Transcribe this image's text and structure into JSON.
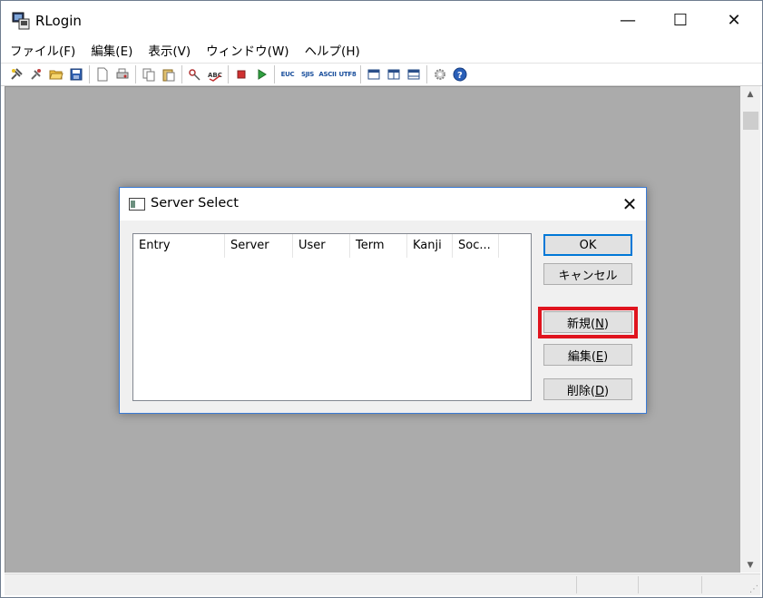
{
  "app": {
    "title": "RLogin",
    "window_controls": {
      "minimize": "—",
      "maximize": "☐",
      "close": "✕"
    }
  },
  "menubar": {
    "items": [
      {
        "name": "file",
        "label": "ファイル(F)"
      },
      {
        "name": "edit",
        "label": "編集(E)"
      },
      {
        "name": "view",
        "label": "表示(V)"
      },
      {
        "name": "window",
        "label": "ウィンドウ(W)"
      },
      {
        "name": "help",
        "label": "ヘルプ(H)"
      }
    ]
  },
  "toolbar": {
    "encoding_labels": {
      "euc": "EUC",
      "sjis": "SJIS",
      "ascii": "ASCII",
      "utf8": "UTF8"
    }
  },
  "dialog": {
    "title": "Server Select",
    "close": "✕",
    "columns": [
      "Entry",
      "Server",
      "User",
      "Term",
      "Kanji",
      "Soc..."
    ],
    "buttons": {
      "ok": "OK",
      "cancel": "キャンセル",
      "new_prefix": "新規(",
      "new_key": "N",
      "edit_prefix": "編集(",
      "edit_key": "E",
      "delete_prefix": "削除(",
      "delete_key": "D",
      "suffix": ")"
    }
  },
  "scrollbar": {
    "up": "▲",
    "down": "▼"
  },
  "colors": {
    "accent": "#0078d7",
    "highlight": "#e0141e",
    "workspace": "#ababab"
  }
}
